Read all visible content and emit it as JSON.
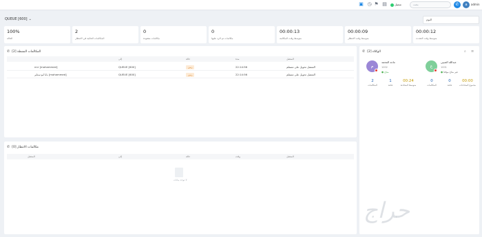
{
  "topbar": {
    "status_label": "متصل",
    "search_placeholder": "بحث",
    "user_name": "admin",
    "avatar_initial": "a",
    "phone_glyph": "✆"
  },
  "queue": {
    "selected": "QUEUE [600]",
    "filter_value": "اليوم"
  },
  "stats": [
    {
      "value": "100%",
      "label": "الحالة"
    },
    {
      "value": "2",
      "label": "المكالمات الحالية في الانتظار"
    },
    {
      "value": "0",
      "label": "مكالمات مفقودة"
    },
    {
      "value": "0",
      "label": "مكالمات تم الرد عليها"
    },
    {
      "value": "00:00:13",
      "label": "متوسط وقت المكالمة"
    },
    {
      "value": "00:00:09",
      "label": "متوسط وقت الانتظار"
    },
    {
      "value": "00:00:12",
      "label": "متوسط وقت التحدث"
    }
  ],
  "active_calls": {
    "title": "المكالمات النشطة [2]",
    "headers": [
      "",
      "إلى",
      "حالة",
      "مدة",
      "المتصل"
    ],
    "rows": [
      {
        "caller": "nnr [mohammed]",
        "to": "QUEUE [600]",
        "status": "رنين",
        "duration": "22:14:56",
        "note": "المتصل تحويل على مستلم"
      },
      {
        "caller": "بابا ابو ستاير [mohammed]",
        "to": "QUEUE [600]",
        "status": "رنين",
        "duration": "22:14:56",
        "note": "المتصل تحويل على مستلم"
      }
    ]
  },
  "waiting_calls": {
    "title": "مكالمات الانتظار [0]",
    "headers": [
      "المتصل",
      "إلى",
      "حالة",
      "وقت",
      "المتصل"
    ],
    "empty_text": "لا توجد بيانات"
  },
  "agents": {
    "title": "الوكلاء [2]",
    "list": [
      {
        "name": "ماجد المحمد",
        "ext": "1002",
        "status": "متاح",
        "initial": "م",
        "color": "#9b87d6",
        "stats": [
          {
            "value": "2",
            "label": "المكالمات"
          },
          {
            "value": "1",
            "label": "فائتة"
          },
          {
            "value": "00:24",
            "label": "متوسط المحادثة"
          }
        ]
      },
      {
        "name": "عبدالله العتيبي",
        "ext": "1001",
        "status": "غير متاح مؤقتا",
        "initial": "ع",
        "color": "#7fcf9a",
        "stats": [
          {
            "value": "0",
            "label": "المكالمات"
          },
          {
            "value": "0",
            "label": "فائتة"
          },
          {
            "value": "00:00",
            "label": "مجموع المحادثات"
          }
        ]
      }
    ]
  },
  "watermark": "حراج"
}
